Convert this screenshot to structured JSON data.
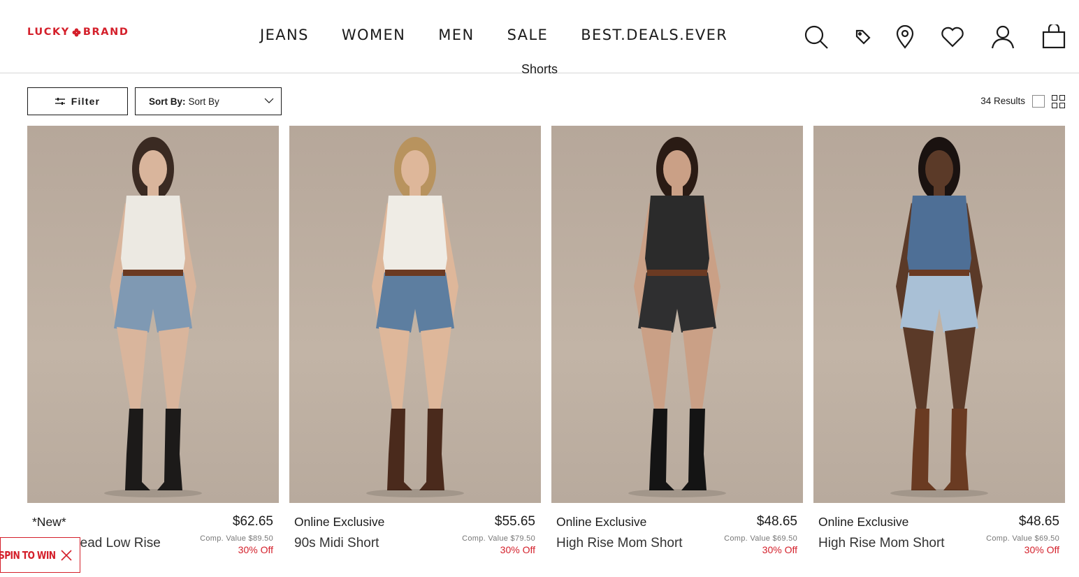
{
  "brand": {
    "left": "LUCKY",
    "right": "BRAND",
    "accent": "#d4202b"
  },
  "nav": [
    "JEANS",
    "WOMEN",
    "MEN",
    "SALE",
    "BEST.DEALS.EVER"
  ],
  "header_icons": [
    "search-icon",
    "tag-icon",
    "location-icon",
    "heart-icon",
    "account-icon",
    "bag-icon"
  ],
  "page": {
    "heading": "Shorts"
  },
  "toolbar": {
    "filter_label": "Filter",
    "sort_prefix": "Sort By:",
    "sort_value": "Sort By",
    "results": "34 Results"
  },
  "products": [
    {
      "badge": "*New*",
      "name": "Lucky Dead Low Rise Short",
      "price": "$62.65",
      "comp_value": "Comp. Value $89.50",
      "discount": "30% Off",
      "colors": {
        "top": "#ece9e2",
        "shorts": "#7f99b3",
        "boots": "#1c1a19",
        "skin": "#d9b59c",
        "hair": "#3a2a22"
      }
    },
    {
      "badge": "Online Exclusive",
      "name": "90s Midi Short",
      "price": "$55.65",
      "comp_value": "Comp. Value $79.50",
      "discount": "30% Off",
      "colors": {
        "top": "#efece5",
        "shorts": "#5d7ea0",
        "boots": "#4a2a1c",
        "skin": "#deb79a",
        "hair": "#b8935e"
      }
    },
    {
      "badge": "Online Exclusive",
      "name": "High Rise Mom Short",
      "price": "$48.65",
      "comp_value": "Comp. Value $69.50",
      "discount": "30% Off",
      "colors": {
        "top": "#2b2b2b",
        "shorts": "#2f2f30",
        "boots": "#141414",
        "skin": "#caa086",
        "hair": "#2a1b14"
      }
    },
    {
      "badge": "Online Exclusive",
      "name": "High Rise Mom Short",
      "price": "$48.65",
      "comp_value": "Comp. Value $69.50",
      "discount": "30% Off",
      "colors": {
        "top": "#4e6f96",
        "shorts": "#a9c0d6",
        "boots": "#6a3b22",
        "skin": "#5b3a28",
        "hair": "#1a1210"
      }
    }
  ],
  "promo": {
    "label": "SPIN TO WIN"
  }
}
